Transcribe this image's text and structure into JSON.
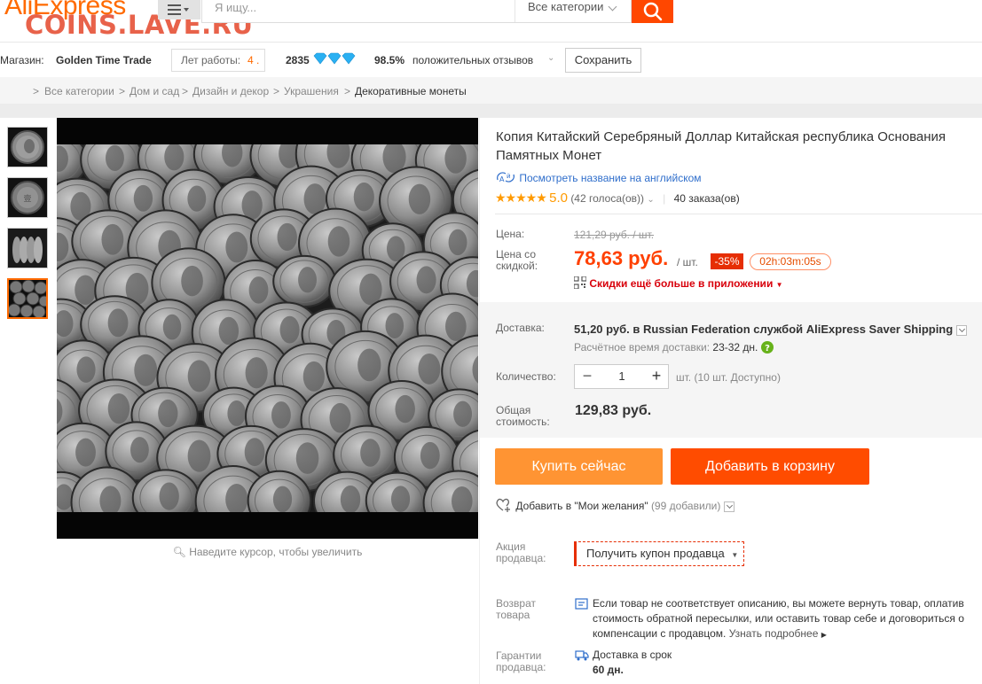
{
  "header": {
    "logo": "AliExpress",
    "watermark": "COINS.LAVE.RU",
    "search_placeholder": "Я ищу...",
    "category_select": "Все категории"
  },
  "store": {
    "label": "Магазин:",
    "name": "Golden Time Trade",
    "years_label": "Лет работы:",
    "years_value": "4",
    "rating_score": "2835",
    "feedback_percent": "98.5%",
    "feedback_label": "положительных отзывов",
    "save_button": "Сохранить"
  },
  "breadcrumb": [
    "Все категории",
    "Дом и сад",
    "Дизайн и декор",
    "Украшения",
    "Декоративные монеты"
  ],
  "gallery": {
    "zoom_hint": "Наведите курсор, чтобы увеличить"
  },
  "product": {
    "title": "Копия Китайский Серебряный Доллар Китайская республика Основания Памятных Монет",
    "translate_link": "Посмотреть название на английском",
    "rating_value": "5.0",
    "votes": "(42 голоса(ов))",
    "orders": "40 заказа(ов)",
    "price_label": "Цена:",
    "old_price": "121,29 руб. / шт.",
    "discount_price_label": "Цена со скидкой:",
    "new_price": "78,63 руб.",
    "unit": "/ шт.",
    "discount": "-35%",
    "timer": "02h:03m:05s",
    "app_promo": "Скидки ещё больше в приложении",
    "shipping_label": "Доставка:",
    "shipping_text": "51,20 руб. в Russian Federation службой AliExpress Saver Shipping",
    "delivery_time_label": "Расчётное время доставки:",
    "delivery_time": "23-32 дн.",
    "quantity_label": "Количество:",
    "quantity": "1",
    "quantity_avail": "шт. (10 шт. Доступно)",
    "total_label": "Общая стоимость:",
    "total": "129,83 руб.",
    "buy_now": "Купить сейчас",
    "add_to_cart": "Добавить в корзину",
    "wishlist_text": "Добавить в \"Мои желания\"",
    "wishlist_count": "(99 добавили)",
    "promo_label": "Акция продавца:",
    "coupon": "Получить купон продавца",
    "return_label": "Возврат товара",
    "return_text": "Если товар не соответствует описанию, вы можете вернуть товар, оплатив стоимость обратной пересылки, или оставить товар себе и договориться о компенсации с продавцом.",
    "return_link": "Узнать подробнее",
    "guarantee_label": "Гарантии продавца:",
    "guarantee_text": "Доставка в срок",
    "guarantee_days": "60 дн."
  },
  "colors": {
    "accent": "#ff4c00",
    "buy_now": "#ff9433",
    "link": "#2f6ecb",
    "promo": "#d8000b"
  }
}
